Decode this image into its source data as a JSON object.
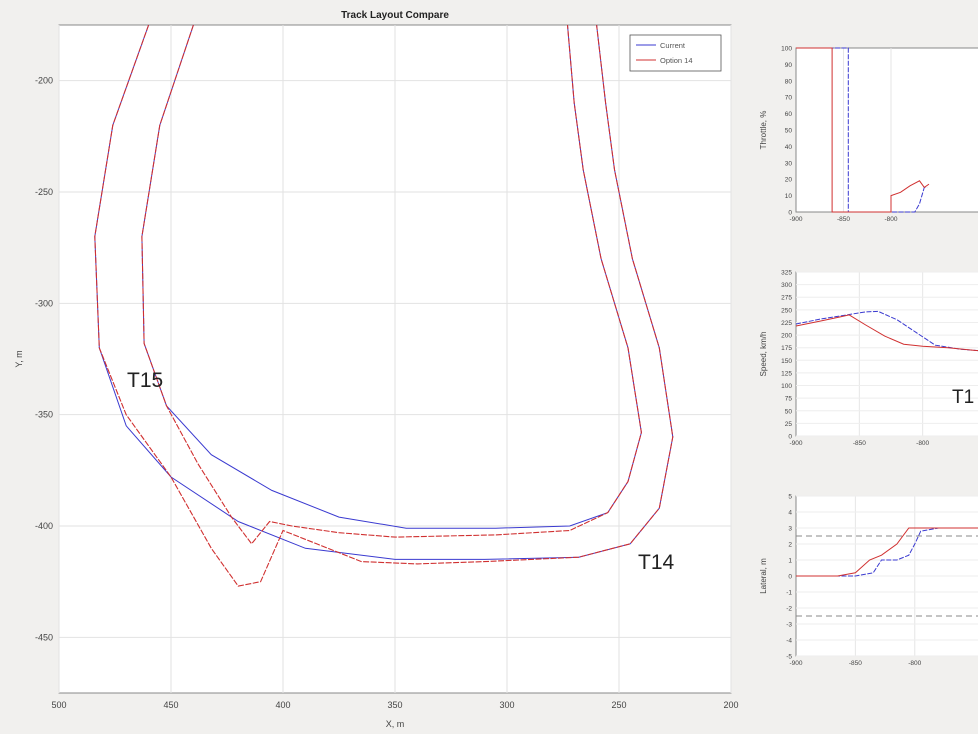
{
  "chart_data": [
    {
      "type": "line",
      "title": "Track Layout Compare",
      "xlabel": "X, m",
      "ylabel": "Y, m",
      "xlim": [
        500,
        200
      ],
      "ylim": [
        -475,
        -175
      ],
      "xticks": [
        500,
        450,
        400,
        350,
        300,
        250,
        200
      ],
      "xtick_labels": [
        "500",
        "450",
        "400",
        "350",
        "300",
        "250",
        "200"
      ],
      "yticks": [
        -200,
        -250,
        -300,
        -350,
        -400,
        -450
      ],
      "ytick_labels": [
        "-200",
        "-250",
        "-300",
        "-350",
        "-400",
        "-450"
      ],
      "grid": true,
      "legend_position": "top-right",
      "annotations": [
        "T15",
        "T14"
      ],
      "series": [
        {
          "name": "Current",
          "color": "#3a3ad0",
          "edges": [
            [
              [
                460,
                -175
              ],
              [
                476,
                -220
              ],
              [
                484,
                -270
              ],
              [
                482,
                -320
              ],
              [
                470,
                -355
              ],
              [
                450,
                -378
              ],
              [
                420,
                -398
              ],
              [
                390,
                -410
              ],
              [
                350,
                -415
              ],
              [
                310,
                -415
              ],
              [
                268,
                -414
              ],
              [
                245,
                -408
              ],
              [
                232,
                -392
              ],
              [
                226,
                -360
              ],
              [
                232,
                -320
              ],
              [
                244,
                -280
              ],
              [
                252,
                -240
              ],
              [
                256,
                -210
              ],
              [
                260,
                -175
              ]
            ],
            [
              [
                440,
                -175
              ],
              [
                455,
                -220
              ],
              [
                463,
                -270
              ],
              [
                462,
                -318
              ],
              [
                452,
                -346
              ],
              [
                432,
                -368
              ],
              [
                405,
                -384
              ],
              [
                375,
                -396
              ],
              [
                345,
                -401
              ],
              [
                305,
                -401
              ],
              [
                272,
                -400
              ],
              [
                255,
                -394
              ],
              [
                246,
                -380
              ],
              [
                240,
                -358
              ],
              [
                246,
                -320
              ],
              [
                258,
                -280
              ],
              [
                266,
                -240
              ],
              [
                270,
                -210
              ],
              [
                273,
                -175
              ]
            ]
          ]
        },
        {
          "name": "Option 14",
          "color": "#d03030",
          "edges": [
            [
              [
                460,
                -175
              ],
              [
                476,
                -220
              ],
              [
                484,
                -270
              ],
              [
                482,
                -320
              ],
              [
                470,
                -350
              ],
              [
                450,
                -378
              ],
              [
                432,
                -410
              ],
              [
                420,
                -427
              ],
              [
                410,
                -425
              ],
              [
                400,
                -402
              ],
              [
                385,
                -408
              ],
              [
                365,
                -416
              ],
              [
                340,
                -417
              ],
              [
                310,
                -416
              ],
              [
                268,
                -414
              ],
              [
                245,
                -408
              ],
              [
                232,
                -392
              ],
              [
                226,
                -360
              ],
              [
                232,
                -320
              ],
              [
                244,
                -280
              ],
              [
                252,
                -240
              ],
              [
                256,
                -210
              ],
              [
                260,
                -175
              ]
            ],
            [
              [
                440,
                -175
              ],
              [
                455,
                -220
              ],
              [
                463,
                -270
              ],
              [
                462,
                -318
              ],
              [
                452,
                -346
              ],
              [
                438,
                -372
              ],
              [
                423,
                -396
              ],
              [
                414,
                -408
              ],
              [
                406,
                -398
              ],
              [
                396,
                -400
              ],
              [
                375,
                -403
              ],
              [
                350,
                -405
              ],
              [
                305,
                -404
              ],
              [
                272,
                -402
              ],
              [
                255,
                -394
              ],
              [
                246,
                -380
              ],
              [
                240,
                -358
              ],
              [
                246,
                -320
              ],
              [
                258,
                -280
              ],
              [
                266,
                -240
              ],
              [
                270,
                -210
              ],
              [
                273,
                -175
              ]
            ]
          ]
        }
      ]
    },
    {
      "type": "line",
      "title": "",
      "xlabel": "",
      "ylabel": "Throttle, %",
      "xlim": [
        -900,
        -700
      ],
      "ylim": [
        0,
        100
      ],
      "xtick_labels": [
        "-900",
        "-850",
        "-800"
      ],
      "ytick_labels": [
        "0",
        "10",
        "20",
        "30",
        "40",
        "50",
        "60",
        "70",
        "80",
        "90",
        "100"
      ],
      "grid": true,
      "series": [
        {
          "name": "Current",
          "color": "#3a3ad0",
          "x": [
            -900,
            -845,
            -845,
            -815,
            -815,
            -775,
            -770,
            -765,
            -762
          ],
          "y": [
            100,
            100,
            0,
            0,
            0,
            0,
            5,
            15,
            15
          ]
        },
        {
          "name": "Option 14",
          "color": "#d03030",
          "x": [
            -900,
            -862,
            -862,
            -800,
            -800,
            -790,
            -780,
            -770,
            -765,
            -760
          ],
          "y": [
            100,
            100,
            0,
            0,
            10,
            12,
            16,
            19,
            15,
            17
          ]
        }
      ]
    },
    {
      "type": "line",
      "title": "",
      "xlabel": "",
      "ylabel": "Speed, km/h",
      "xlim": [
        -900,
        -750
      ],
      "ylim": [
        0,
        325
      ],
      "xtick_labels": [
        "-900",
        "-850",
        "-800"
      ],
      "ytick_labels": [
        "0",
        "25",
        "50",
        "75",
        "100",
        "125",
        "150",
        "175",
        "200",
        "225",
        "250",
        "275",
        "300",
        "325"
      ],
      "grid": true,
      "annotations": [
        "T1"
      ],
      "series": [
        {
          "name": "Current",
          "color": "#3a3ad0",
          "x": [
            -900,
            -880,
            -860,
            -845,
            -835,
            -820,
            -805,
            -790,
            -770,
            -750
          ],
          "y": [
            222,
            232,
            240,
            246,
            247,
            230,
            205,
            180,
            172,
            168
          ]
        },
        {
          "name": "Option 14",
          "color": "#d03030",
          "x": [
            -900,
            -880,
            -865,
            -858,
            -845,
            -830,
            -815,
            -800,
            -780,
            -760,
            -750
          ],
          "y": [
            218,
            228,
            236,
            240,
            220,
            198,
            182,
            178,
            175,
            170,
            168
          ]
        }
      ]
    },
    {
      "type": "line",
      "title": "",
      "xlabel": "",
      "ylabel": "Lateral, m",
      "xlim": [
        -900,
        -740
      ],
      "ylim": [
        -5,
        5
      ],
      "xtick_labels": [
        "-900",
        "-850",
        "-800"
      ],
      "ytick_labels": [
        "5",
        "4",
        "3",
        "2",
        "1",
        "0",
        "-1",
        "-2",
        "-3",
        "-4",
        "-5"
      ],
      "grid": true,
      "reference_lines": [
        2.5,
        -2.5
      ],
      "series": [
        {
          "name": "Current",
          "color": "#3a3ad0",
          "x": [
            -900,
            -865,
            -850,
            -835,
            -828,
            -815,
            -805,
            -800,
            -795,
            -780,
            -760,
            -740
          ],
          "y": [
            0,
            0,
            0,
            0.2,
            1,
            1,
            1.3,
            2,
            2.8,
            3,
            3,
            3
          ]
        },
        {
          "name": "Option 14",
          "color": "#d03030",
          "x": [
            -900,
            -865,
            -850,
            -838,
            -828,
            -815,
            -805,
            -798,
            -790,
            -760,
            -740
          ],
          "y": [
            0,
            0,
            0.2,
            1,
            1.3,
            2,
            3,
            3,
            3,
            3,
            3
          ]
        }
      ]
    }
  ]
}
